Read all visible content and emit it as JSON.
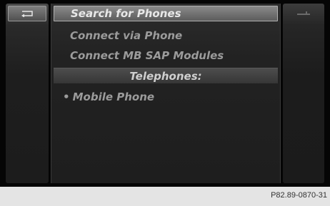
{
  "menu": {
    "search_label": "Search for Phones",
    "connect_phone_label": "Connect via Phone",
    "connect_sap_label": "Connect MB SAP Modules",
    "section_header": "Telephones:",
    "phones": [
      {
        "bullet": "•",
        "label": "Mobile Phone"
      }
    ]
  },
  "caption": {
    "figure_code": "P82.89-0870-31"
  },
  "icons": {
    "back": "back-arrow-icon",
    "right": "dash-icon"
  },
  "colors": {
    "screen_background": "#050505",
    "text": "#9b9b9b",
    "selected_text": "#e8e8e8",
    "caption_background": "#e4e4e4"
  }
}
